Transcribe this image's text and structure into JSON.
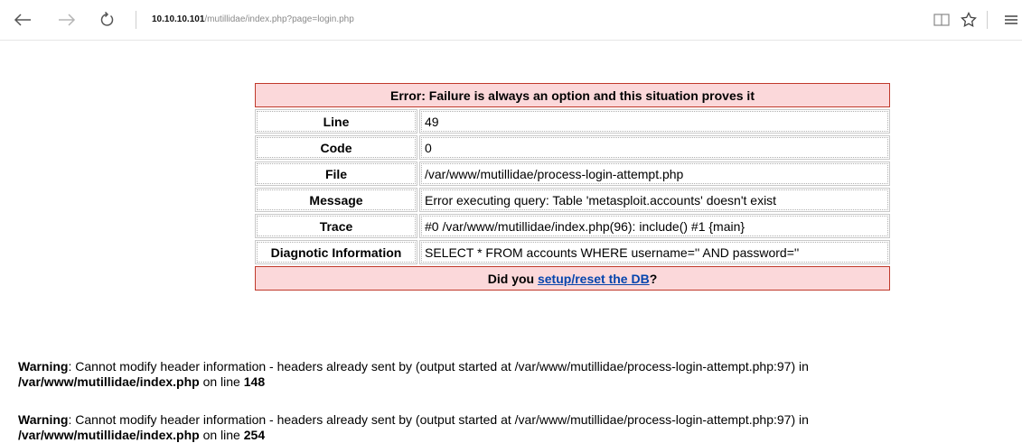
{
  "browser": {
    "url_host": "10.10.10.101",
    "url_path": "/mutillidae/index.php?page=login.php"
  },
  "error": {
    "title": "Error: Failure is always an option and this situation proves it",
    "rows": [
      {
        "label": "Line",
        "value": "49"
      },
      {
        "label": "Code",
        "value": "0"
      },
      {
        "label": "File",
        "value": "/var/www/mutillidae/process-login-attempt.php"
      },
      {
        "label": "Message",
        "value": "Error executing query: Table 'metasploit.accounts' doesn't exist"
      },
      {
        "label": "Trace",
        "value": "#0 /var/www/mutillidae/index.php(96): include() #1 {main}"
      },
      {
        "label": "Diagnotic Information",
        "value": "SELECT * FROM accounts WHERE username='' AND password=''"
      }
    ],
    "footer_prefix": "Did you ",
    "footer_link": "setup/reset the DB",
    "footer_suffix": "?"
  },
  "warnings": [
    {
      "label": "Warning",
      "text": ": Cannot modify header information - headers already sent by (output started at /var/www/mutillidae/process-login-attempt.php:97) in",
      "file": "/var/www/mutillidae/index.php",
      "online": " on line ",
      "line": "148"
    },
    {
      "label": "Warning",
      "text": ": Cannot modify header information - headers already sent by (output started at /var/www/mutillidae/process-login-attempt.php:97) in",
      "file": "/var/www/mutillidae/index.php",
      "online": " on line ",
      "line": "254"
    }
  ],
  "colors": {
    "header_bg": "#fbd8da",
    "header_border": "#c0392b",
    "link": "#0645ad"
  }
}
